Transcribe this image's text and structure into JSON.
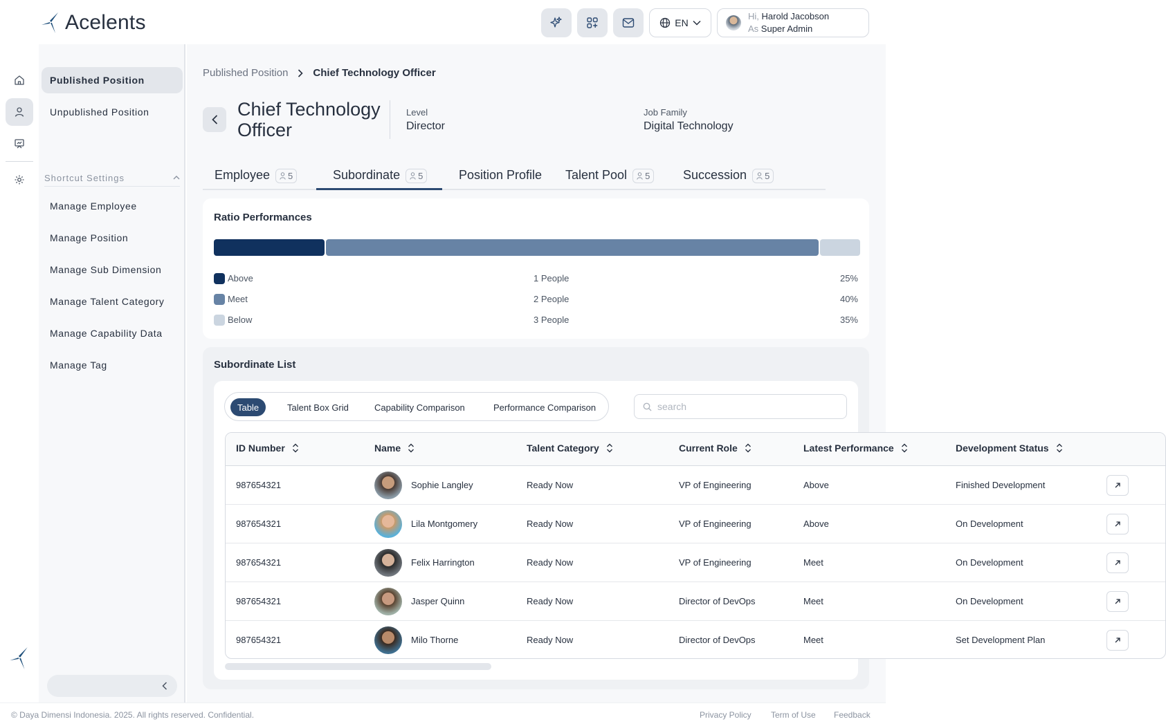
{
  "brand": {
    "name": "Acelents"
  },
  "header": {
    "language": "EN",
    "user": {
      "greeting_prefix": "Hi,",
      "name": "Harold Jacobson",
      "role_prefix": "As",
      "role": "Super Admin"
    }
  },
  "sidebar": {
    "items": [
      {
        "label": "Published Position"
      },
      {
        "label": "Unpublished Position"
      }
    ],
    "shortcut_title": "Shortcut Settings",
    "shortcuts": [
      {
        "label": "Manage Employee"
      },
      {
        "label": "Manage Position"
      },
      {
        "label": "Manage Sub Dimension"
      },
      {
        "label": "Manage Talent Category"
      },
      {
        "label": "Manage Capability Data"
      },
      {
        "label": "Manage Tag"
      }
    ]
  },
  "breadcrumb": {
    "parent": "Published Position",
    "current": "Chief Technology Officer"
  },
  "position": {
    "title": "Chief Technology Officer",
    "level_label": "Level",
    "level_value": "Director",
    "family_label": "Job Family",
    "family_value": "Digital Technology"
  },
  "tabs": [
    {
      "label": "Employee",
      "count": "5"
    },
    {
      "label": "Subordinate",
      "count": "5"
    },
    {
      "label": "Position Profile",
      "count": ""
    },
    {
      "label": "Talent Pool",
      "count": "5"
    },
    {
      "label": "Succession",
      "count": "5"
    }
  ],
  "ratio": {
    "title": "Ratio Performances",
    "rows": [
      {
        "label": "Above",
        "count": "1 People",
        "percent": "25%",
        "color": "#10315e"
      },
      {
        "label": "Meet",
        "count": "2 People",
        "percent": "40%",
        "color": "#6783a5"
      },
      {
        "label": "Below",
        "count": "3 People",
        "percent": "35%",
        "color": "#cbd5e0"
      }
    ]
  },
  "subordinates": {
    "title": "Subordinate List",
    "views": [
      "Table",
      "Talent Box Grid",
      "Capability Comparison",
      "Performance Comparison"
    ],
    "search_placeholder": "search",
    "columns": [
      "ID Number",
      "Name",
      "Talent Category",
      "Current Role",
      "Latest Performance",
      "Development Status"
    ],
    "rows": [
      {
        "id": "987654321",
        "name": "Sophie Langley",
        "category": "Ready Now",
        "role": "VP of Engineering",
        "performance": "Above",
        "status": "Finished Development"
      },
      {
        "id": "987654321",
        "name": "Lila Montgomery",
        "category": "Ready Now",
        "role": "VP of Engineering",
        "performance": "Above",
        "status": "On Development"
      },
      {
        "id": "987654321",
        "name": "Felix Harrington",
        "category": "Ready Now",
        "role": "VP of Engineering",
        "performance": "Meet",
        "status": "On Development"
      },
      {
        "id": "987654321",
        "name": "Jasper Quinn",
        "category": "Ready Now",
        "role": "Director of DevOps",
        "performance": "Meet",
        "status": "On Development"
      },
      {
        "id": "987654321",
        "name": "Milo Thorne",
        "category": "Ready Now",
        "role": "Director of DevOps",
        "performance": "Meet",
        "status": "Set Development Plan"
      }
    ]
  },
  "footer": {
    "copyright": "© Daya Dimensi Indonesia. 2025. All rights reserved. Confidential.",
    "links": [
      "Privacy Policy",
      "Term of Use",
      "Feedback"
    ]
  }
}
